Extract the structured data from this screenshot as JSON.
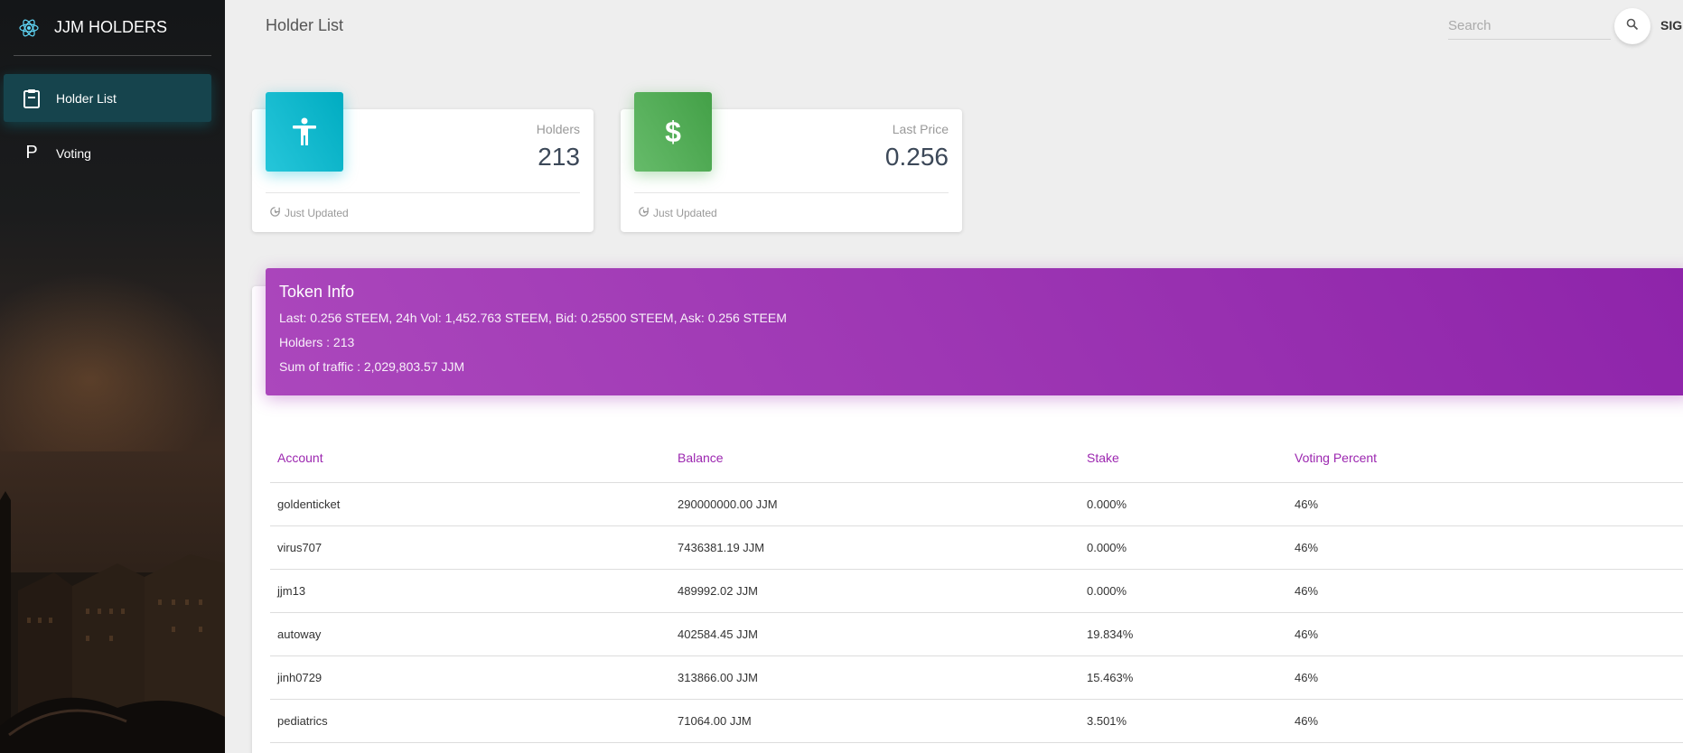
{
  "brand": {
    "title": "JJM HOLDERS"
  },
  "sidebar": {
    "items": [
      {
        "label": "Holder List",
        "icon": "clipboard-icon",
        "active": true
      },
      {
        "label": "Voting",
        "icon": "P",
        "active": false
      }
    ]
  },
  "header": {
    "title": "Holder List",
    "search_placeholder": "Search",
    "signin_label": "SIGN"
  },
  "cards": [
    {
      "label": "Holders",
      "value": "213",
      "footer": "Just Updated",
      "color": "#26c6da",
      "icon": "accessibility-icon"
    },
    {
      "label": "Last Price",
      "value": "0.256",
      "footer": "Just Updated",
      "color": "#4caf50",
      "icon": "dollar-icon"
    }
  ],
  "token_info": {
    "title": "Token Info",
    "line1": "Last: 0.256 STEEM, 24h Vol: 1,452.763 STEEM, Bid: 0.25500 STEEM, Ask: 0.256 STEEM",
    "line2": "Holders : 213",
    "line3": "Sum of traffic : 2,029,803.57 JJM",
    "color": "#9c27b0"
  },
  "table": {
    "headers": [
      "Account",
      "Balance",
      "Stake",
      "Voting Percent"
    ],
    "rows": [
      [
        "goldenticket",
        "290000000.00 JJM",
        "0.000%",
        "46%"
      ],
      [
        "virus707",
        "7436381.19 JJM",
        "0.000%",
        "46%"
      ],
      [
        "jjm13",
        "489992.02 JJM",
        "0.000%",
        "46%"
      ],
      [
        "autoway",
        "402584.45 JJM",
        "19.834%",
        "46%"
      ],
      [
        "jinh0729",
        "313866.00 JJM",
        "15.463%",
        "46%"
      ],
      [
        "pediatrics",
        "71064.00 JJM",
        "3.501%",
        "46%"
      ]
    ]
  }
}
